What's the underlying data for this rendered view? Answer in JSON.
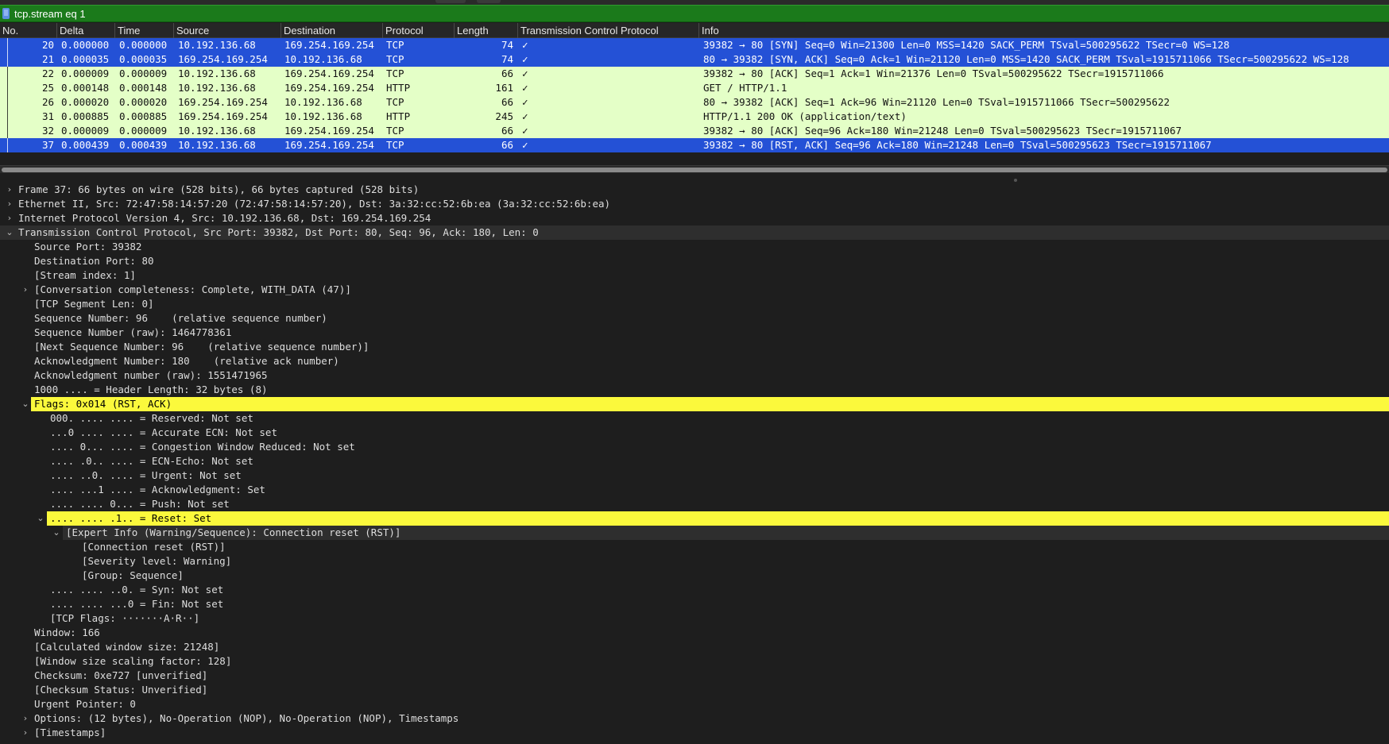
{
  "filter": {
    "value": "tcp.stream eq 1"
  },
  "columns": {
    "no": "No.",
    "delta": "Delta",
    "time": "Time",
    "source": "Source",
    "destination": "Destination",
    "protocol": "Protocol",
    "length": "Length",
    "tcp": "Transmission Control Protocol",
    "info": "Info"
  },
  "packets": [
    {
      "no": "20",
      "delta": "0.000000",
      "time": "0.000000",
      "source": "10.192.136.68",
      "destination": "169.254.169.254",
      "protocol": "TCP",
      "length": "74",
      "tcp": "✓",
      "info": "39382 → 80 [SYN] Seq=0 Win=21300 Len=0 MSS=1420 SACK_PERM TSval=500295622 TSecr=0 WS=128"
    },
    {
      "no": "21",
      "delta": "0.000035",
      "time": "0.000035",
      "source": "169.254.169.254",
      "destination": "10.192.136.68",
      "protocol": "TCP",
      "length": "74",
      "tcp": "✓",
      "info": "80 → 39382 [SYN, ACK] Seq=0 Ack=1 Win=21120 Len=0 MSS=1420 SACK_PERM TSval=1915711066 TSecr=500295622 WS=128"
    },
    {
      "no": "22",
      "delta": "0.000009",
      "time": "0.000009",
      "source": "10.192.136.68",
      "destination": "169.254.169.254",
      "protocol": "TCP",
      "length": "66",
      "tcp": "✓",
      "info": "39382 → 80 [ACK] Seq=1 Ack=1 Win=21376 Len=0 TSval=500295622 TSecr=1915711066"
    },
    {
      "no": "25",
      "delta": "0.000148",
      "time": "0.000148",
      "source": "10.192.136.68",
      "destination": "169.254.169.254",
      "protocol": "HTTP",
      "length": "161",
      "tcp": "✓",
      "info": "GET / HTTP/1.1"
    },
    {
      "no": "26",
      "delta": "0.000020",
      "time": "0.000020",
      "source": "169.254.169.254",
      "destination": "10.192.136.68",
      "protocol": "TCP",
      "length": "66",
      "tcp": "✓",
      "info": "80 → 39382 [ACK] Seq=1 Ack=96 Win=21120 Len=0 TSval=1915711066 TSecr=500295622"
    },
    {
      "no": "31",
      "delta": "0.000885",
      "time": "0.000885",
      "source": "169.254.169.254",
      "destination": "10.192.136.68",
      "protocol": "HTTP",
      "length": "245",
      "tcp": "✓",
      "info": "HTTP/1.1 200 OK  (application/text)"
    },
    {
      "no": "32",
      "delta": "0.000009",
      "time": "0.000009",
      "source": "10.192.136.68",
      "destination": "169.254.169.254",
      "protocol": "TCP",
      "length": "66",
      "tcp": "✓",
      "info": "39382 → 80 [ACK] Seq=96 Ack=180 Win=21248 Len=0 TSval=500295623 TSecr=1915711067"
    },
    {
      "no": "37",
      "delta": "0.000439",
      "time": "0.000439",
      "source": "10.192.136.68",
      "destination": "169.254.169.254",
      "protocol": "TCP",
      "length": "66",
      "tcp": "✓",
      "info": "39382 → 80 [RST, ACK] Seq=96 Ack=180 Win=21248 Len=0 TSval=500295623 TSecr=1915711067"
    }
  ],
  "details": [
    {
      "arrow": "›",
      "text": "Frame 37: 66 bytes on wire (528 bits), 66 bytes captured (528 bits)"
    },
    {
      "arrow": "›",
      "text": "Ethernet II, Src: 72:47:58:14:57:20 (72:47:58:14:57:20), Dst: 3a:32:cc:52:6b:ea (3a:32:cc:52:6b:ea)"
    },
    {
      "arrow": "›",
      "text": "Internet Protocol Version 4, Src: 10.192.136.68, Dst: 169.254.169.254"
    },
    {
      "arrow": "⌄",
      "text": "Transmission Control Protocol, Src Port: 39382, Dst Port: 80, Seq: 96, Ack: 180, Len: 0"
    },
    {
      "arrow": "",
      "text": "Source Port: 39382"
    },
    {
      "arrow": "",
      "text": "Destination Port: 80"
    },
    {
      "arrow": "",
      "text": "[Stream index: 1]"
    },
    {
      "arrow": "›",
      "text": "[Conversation completeness: Complete, WITH_DATA (47)]"
    },
    {
      "arrow": "",
      "text": "[TCP Segment Len: 0]"
    },
    {
      "arrow": "",
      "text": "Sequence Number: 96    (relative sequence number)"
    },
    {
      "arrow": "",
      "text": "Sequence Number (raw): 1464778361"
    },
    {
      "arrow": "",
      "text": "[Next Sequence Number: 96    (relative sequence number)]"
    },
    {
      "arrow": "",
      "text": "Acknowledgment Number: 180    (relative ack number)"
    },
    {
      "arrow": "",
      "text": "Acknowledgment number (raw): 1551471965"
    },
    {
      "arrow": "",
      "text": "1000 .... = Header Length: 32 bytes (8)"
    },
    {
      "arrow": "⌄",
      "text": "Flags: 0x014 (RST, ACK)"
    },
    {
      "arrow": "",
      "text": "000. .... .... = Reserved: Not set"
    },
    {
      "arrow": "",
      "text": "...0 .... .... = Accurate ECN: Not set"
    },
    {
      "arrow": "",
      "text": ".... 0... .... = Congestion Window Reduced: Not set"
    },
    {
      "arrow": "",
      "text": ".... .0.. .... = ECN-Echo: Not set"
    },
    {
      "arrow": "",
      "text": ".... ..0. .... = Urgent: Not set"
    },
    {
      "arrow": "",
      "text": ".... ...1 .... = Acknowledgment: Set"
    },
    {
      "arrow": "",
      "text": ".... .... 0... = Push: Not set"
    },
    {
      "arrow": "⌄",
      "text": ".... .... .1.. = Reset: Set"
    },
    {
      "arrow": "⌄",
      "text": "[Expert Info (Warning/Sequence): Connection reset (RST)]"
    },
    {
      "arrow": "",
      "text": "[Connection reset (RST)]"
    },
    {
      "arrow": "",
      "text": "[Severity level: Warning]"
    },
    {
      "arrow": "",
      "text": "[Group: Sequence]"
    },
    {
      "arrow": "",
      "text": ".... .... ..0. = Syn: Not set"
    },
    {
      "arrow": "",
      "text": ".... .... ...0 = Fin: Not set"
    },
    {
      "arrow": "",
      "text": "[TCP Flags: ·······A·R··]"
    },
    {
      "arrow": "",
      "text": "Window: 166"
    },
    {
      "arrow": "",
      "text": "[Calculated window size: 21248]"
    },
    {
      "arrow": "",
      "text": "[Window size scaling factor: 128]"
    },
    {
      "arrow": "",
      "text": "Checksum: 0xe727 [unverified]"
    },
    {
      "arrow": "",
      "text": "[Checksum Status: Unverified]"
    },
    {
      "arrow": "",
      "text": "Urgent Pointer: 0"
    },
    {
      "arrow": "›",
      "text": "Options: (12 bytes), No-Operation (NOP), No-Operation (NOP), Timestamps"
    },
    {
      "arrow": "›",
      "text": "[Timestamps]"
    }
  ],
  "colors": {
    "selected_row": "#2451d6",
    "green_row": "#e4ffc7",
    "filter_bar": "#1b7a1b",
    "highlight_yellow": "#fbf93c"
  }
}
